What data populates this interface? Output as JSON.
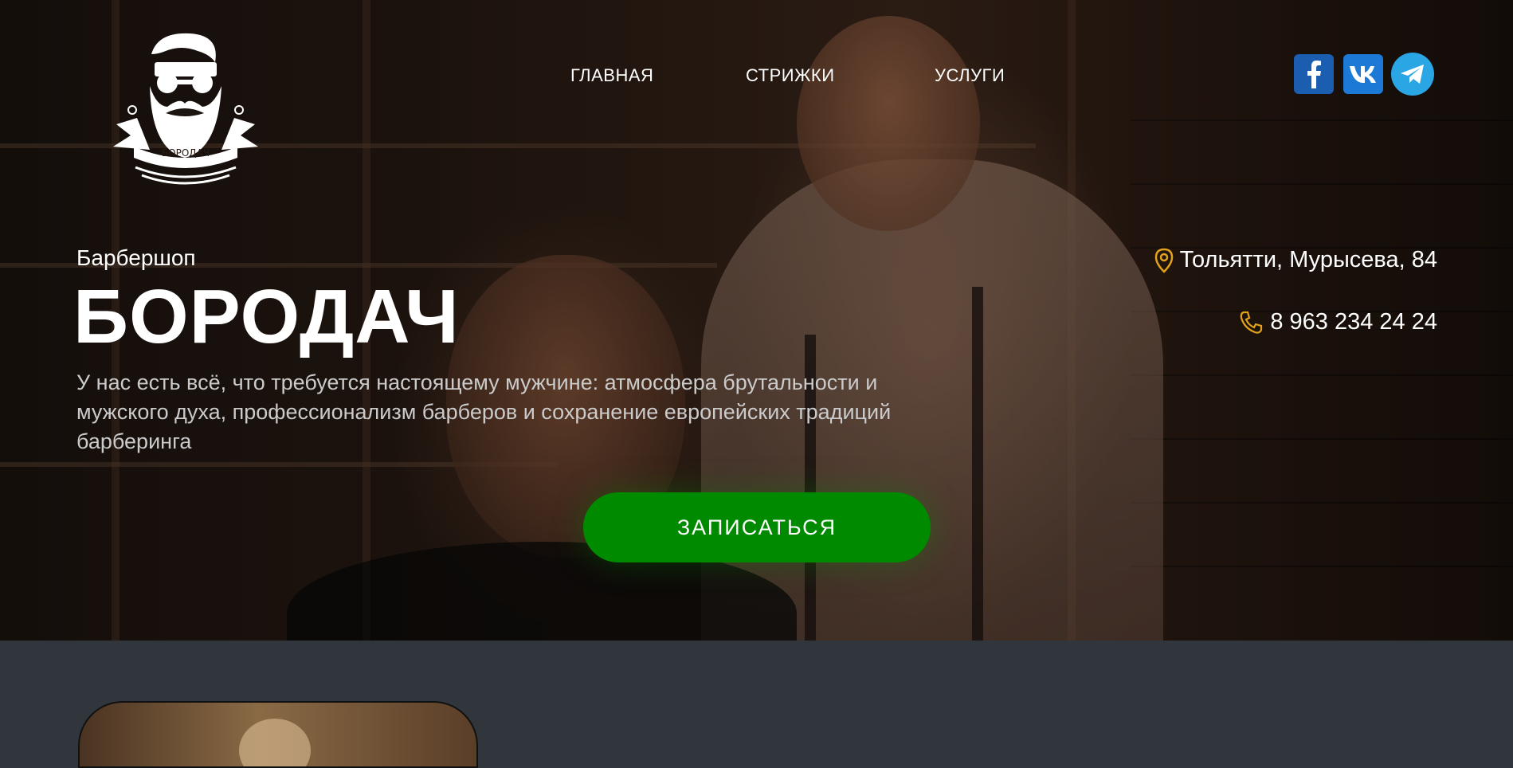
{
  "logo": {
    "name": "БОРОДАЧ",
    "icon": "barber-beard-logo-icon"
  },
  "nav": {
    "items": [
      {
        "label": "ГЛАВНАЯ"
      },
      {
        "label": "СТРИЖКИ"
      },
      {
        "label": "УСЛУГИ"
      }
    ]
  },
  "social": [
    {
      "icon": "facebook-icon",
      "color": "#1b5dae"
    },
    {
      "icon": "vk-icon",
      "color": "#1c7ad6"
    },
    {
      "icon": "telegram-icon",
      "color": "#2ba6e4"
    }
  ],
  "hero": {
    "subtitle": "Барбершоп",
    "title": "БОРОДАЧ",
    "description": "У нас есть всё, что требуется настоящему мужчине: атмосфера брутальности и мужского духа, профессионализм барберов и сохранение европейских традиций барберинга",
    "cta_label": "ЗАПИСАТЬСЯ",
    "cta_color": "#008a00"
  },
  "contacts": {
    "address": "Тольятти, Мурысева, 84",
    "phone": "8 963 234 24 24",
    "icon_color": "#e2a21c",
    "address_icon": "map-pin-icon",
    "phone_icon": "phone-icon"
  },
  "colors": {
    "below_hero_bg": "#31363d"
  }
}
